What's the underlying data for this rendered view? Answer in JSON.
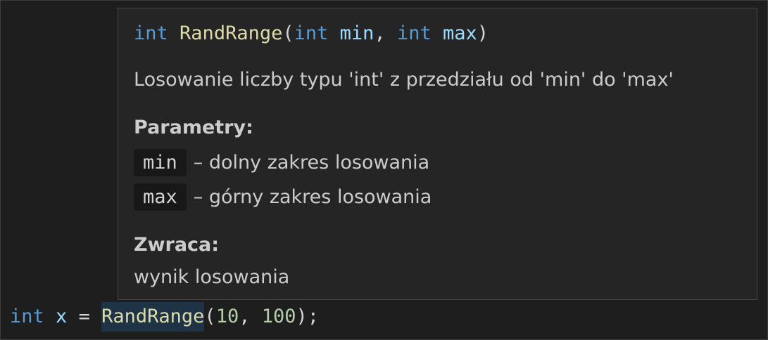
{
  "hover": {
    "signature": {
      "return_type": "int",
      "name": "RandRange",
      "open_paren": "(",
      "param1_type": "int",
      "param1_name": "min",
      "comma": ", ",
      "param2_type": "int",
      "param2_name": "max",
      "close_paren": ")"
    },
    "description": "Losowanie liczby typu 'int' z przedziału od 'min' do 'max'",
    "params_header": "Parametry:",
    "params": [
      {
        "name": "min",
        "text": "– dolny zakres losowania"
      },
      {
        "name": "max",
        "text": "– górny zakres losowania"
      }
    ],
    "returns_header": "Zwraca:",
    "returns_text": "wynik losowania"
  },
  "code": {
    "type": "int",
    "var": "x",
    "eq": "=",
    "func": "RandRange",
    "open_paren": "(",
    "arg1": "10",
    "comma": ", ",
    "arg2": "100",
    "close": ");"
  },
  "colors": {
    "background": "#1e1e1e",
    "hover_background": "#252526",
    "keyword": "#569cd6",
    "function": "#dcdcaa",
    "parameter": "#9cdcfe",
    "number": "#b5cea8",
    "text": "#cccccc"
  }
}
